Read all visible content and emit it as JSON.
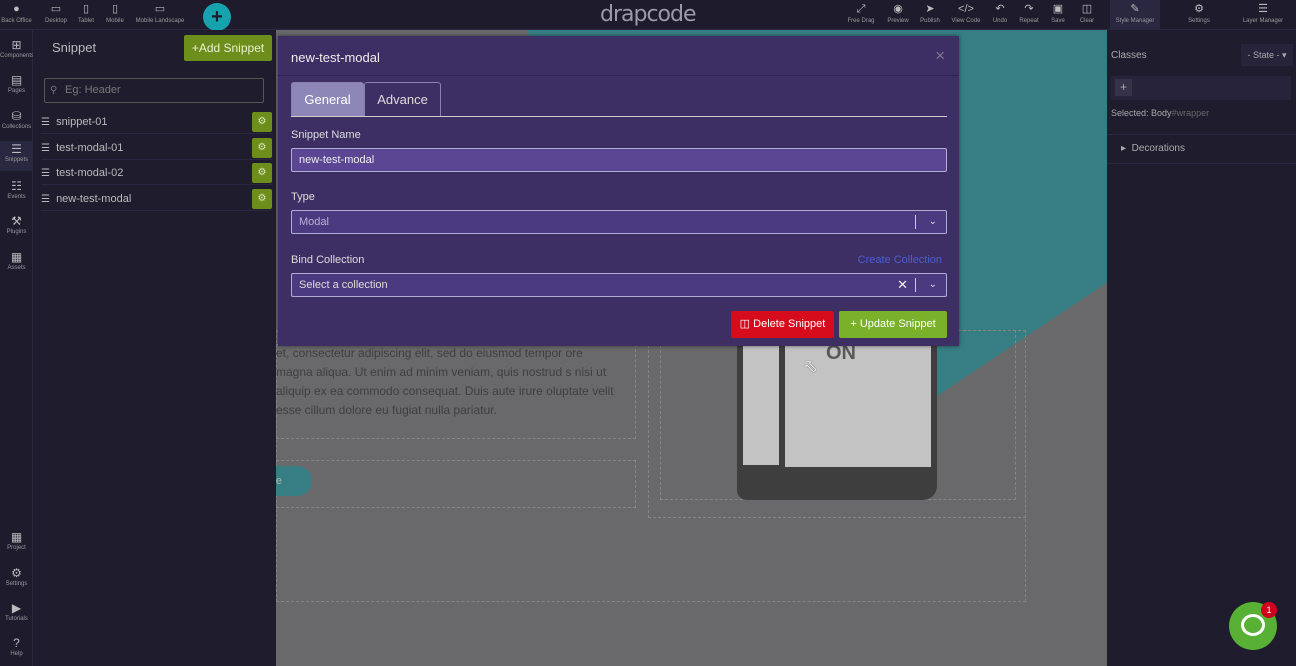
{
  "topbar": {
    "logo": "drapcode",
    "back_office": "Back Office",
    "devices": [
      {
        "label": "Desktop",
        "icon": "desktop-icon"
      },
      {
        "label": "Tablet",
        "icon": "tablet-icon"
      },
      {
        "label": "Mobile",
        "icon": "mobile-icon"
      },
      {
        "label": "Mobile Landscape",
        "icon": "mobile-landscape-icon"
      }
    ],
    "actions": [
      {
        "label": "Free Drag",
        "icon": "free-drag-icon"
      },
      {
        "label": "Preview",
        "icon": "eye-icon"
      },
      {
        "label": "Publish",
        "icon": "send-icon"
      },
      {
        "label": "View Code",
        "icon": "code-icon"
      },
      {
        "label": "Undo",
        "icon": "undo-icon"
      },
      {
        "label": "Repeat",
        "icon": "redo-icon"
      },
      {
        "label": "Save",
        "icon": "save-icon"
      },
      {
        "label": "Clear",
        "icon": "trash-icon"
      }
    ],
    "right_tabs": [
      {
        "label": "Style Manager",
        "icon": "brush-icon"
      },
      {
        "label": "Settings",
        "icon": "gear-icon"
      },
      {
        "label": "Layer Manager",
        "icon": "layers-icon"
      }
    ]
  },
  "leftnav": {
    "items": [
      {
        "label": "Components",
        "icon": "plus-box-icon"
      },
      {
        "label": "Pages",
        "icon": "page-icon"
      },
      {
        "label": "Collections",
        "icon": "database-icon"
      },
      {
        "label": "Snippets",
        "icon": "menu-icon"
      },
      {
        "label": "Events",
        "icon": "sitemap-icon"
      },
      {
        "label": "Plugins",
        "icon": "tools-icon"
      },
      {
        "label": "Assets",
        "icon": "image-icon"
      }
    ],
    "bottom_items": [
      {
        "label": "Project",
        "icon": "project-icon"
      },
      {
        "label": "Settings",
        "icon": "cogs-icon"
      },
      {
        "label": "Tutorials",
        "icon": "youtube-icon"
      },
      {
        "label": "Help",
        "icon": "help-icon"
      }
    ]
  },
  "snippet_panel": {
    "title": "Snippet",
    "add_label": "Add Snippet",
    "search_placeholder": "Eg: Header",
    "items": [
      "snippet-01",
      "test-modal-01",
      "test-modal-02",
      "new-test-modal"
    ]
  },
  "canvas": {
    "paragraph": "et, consectetur adipiscing elit, sed do eiusmod tempor ore magna aliqua. Ut enim ad minim veniam, quis nostrud s nisi ut aliquip ex ea commodo consequat. Duis aute irure oluptate velit esse cillum dolore eu fugiat nulla pariatur.",
    "button_text": "e",
    "phone_text": "ON"
  },
  "modal": {
    "title": "new-test-modal",
    "close_symbol": "×",
    "tabs": [
      "General",
      "Advance"
    ],
    "snippet_name_label": "Snippet Name",
    "snippet_name_value": "new-test-modal",
    "type_label": "Type",
    "type_value": "Modal",
    "bind_label": "Bind Collection",
    "bind_placeholder": "Select a collection",
    "create_collection": "Create Collection",
    "delete_label": "Delete Snippet",
    "update_label": "Update Snippet"
  },
  "right_panel": {
    "classes_label": "Classes",
    "state_label": "- State -",
    "selected_label": "Selected:",
    "selected_value": "Body",
    "selected_id": "#wrapper",
    "decorations_label": "Decorations"
  },
  "chat": {
    "badge": "1"
  },
  "colors": {
    "accent_green": "#6e8e1c",
    "modal_bg": "#3d2f63",
    "delete_red": "#d60c1c",
    "update_green": "#7ab12a",
    "teal": "#17a2ae"
  }
}
